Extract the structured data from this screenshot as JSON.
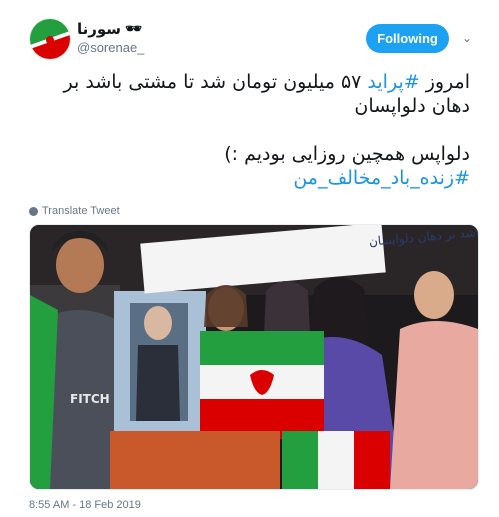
{
  "user": {
    "display_name": "سورنا",
    "name_emoji": "🕶",
    "handle": "@sorenae_"
  },
  "follow_button": "Following",
  "tweet": {
    "line1_before": "امروز ",
    "hashtag1": "#پراید",
    "line1_after": " ۵۷ میلیون تومان شد تا مشتی باشد بر دهان دلواپسان",
    "line2": "دلواپس همچین روزایی بودیم :)",
    "hashtag2": "#زنده_باد_مخالف_من"
  },
  "translate_label": "Translate Tweet",
  "photo": {
    "sign_text": "آمدیم تا مشتی باشد بر دهان دلواپسان",
    "shirt_text": "FITCH"
  },
  "timestamp": "8:55 AM - 18 Feb 2019",
  "colors": {
    "accent": "#1da1f2",
    "hashtag": "#1b95e0",
    "muted": "#657786"
  }
}
